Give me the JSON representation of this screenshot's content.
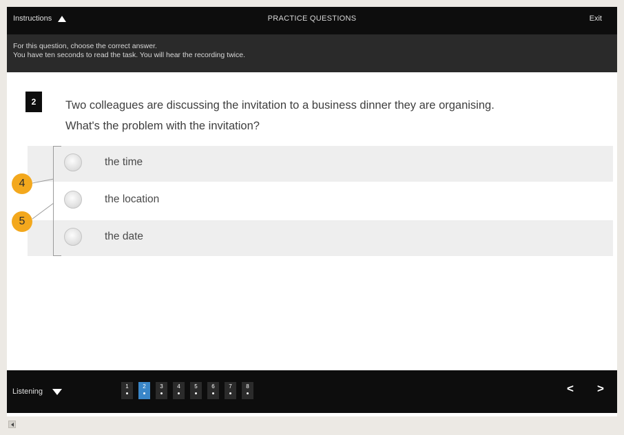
{
  "header": {
    "instructions_label": "Instructions",
    "title": "PRACTICE QUESTIONS",
    "exit_label": "Exit"
  },
  "instructions": {
    "line1": "For this question, choose the correct answer.",
    "line2": "You have ten seconds to read the task. You will hear the recording twice."
  },
  "question": {
    "number": "2",
    "text_line1": "Two colleagues are discussing the invitation to a business dinner they are organising.",
    "text_line2": "What's the problem with the invitation?",
    "options": [
      {
        "label": "the time",
        "selected": false
      },
      {
        "label": "the location",
        "selected": false
      },
      {
        "label": "the date",
        "selected": false
      }
    ]
  },
  "footer": {
    "section_label": "Listening",
    "question_nav": [
      "1",
      "2",
      "3",
      "4",
      "5",
      "6",
      "7",
      "8"
    ],
    "active_question": "2",
    "prev_label": "<",
    "next_label": ">"
  },
  "callouts": [
    "4",
    "5"
  ],
  "colors": {
    "bar_bg": "#0d0d0d",
    "instructions_bg": "#2a2a2a",
    "active_nav": "#3a86c8",
    "callout": "#f3a81d",
    "option_shade": "#eeeeee"
  }
}
